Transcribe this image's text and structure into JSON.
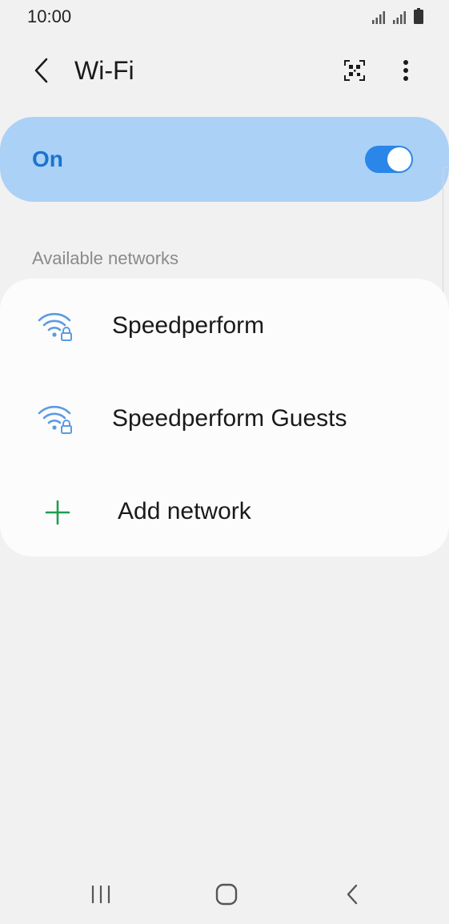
{
  "status_bar": {
    "time": "10:00",
    "icons": [
      "signal-icon",
      "signal-icon",
      "battery-icon"
    ]
  },
  "header": {
    "title": "Wi-Fi",
    "back_icon": "back-arrow-icon",
    "qr_icon": "qr-code-scan-icon",
    "more_icon": "more-options-icon"
  },
  "wifi_toggle": {
    "label": "On",
    "state": true,
    "accent": "#1a73cf",
    "card_color": "#abd1f7",
    "switch_color": "#2a86e8"
  },
  "available_networks": {
    "title": "Available networks",
    "items": [
      {
        "ssid": "Speedperform",
        "icon": "wifi-lock-icon"
      },
      {
        "ssid": "Speedperform Guests",
        "icon": "wifi-lock-icon"
      }
    ],
    "add": {
      "label": "Add network",
      "icon": "plus-icon",
      "color": "#1e9e4f"
    }
  },
  "nav_bar": {
    "icons": [
      "recents-icon",
      "home-icon",
      "back-icon"
    ]
  }
}
